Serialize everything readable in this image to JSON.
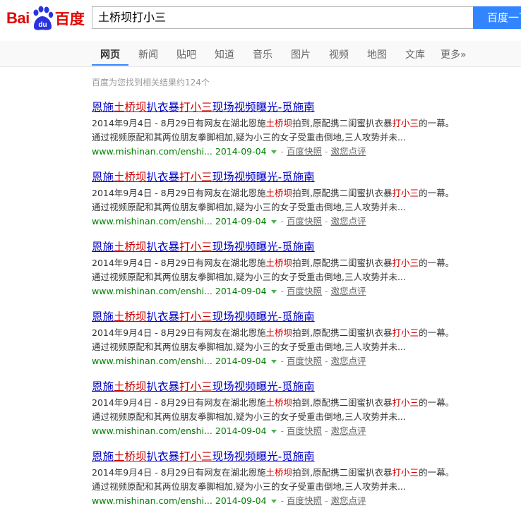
{
  "logo": {
    "latin_part": "Bai",
    "paw_text": "du",
    "chinese_part": "百度"
  },
  "search": {
    "query": "土桥坝打小三",
    "button_label": "百度一下"
  },
  "tabs": [
    {
      "label": "网页",
      "active": true
    },
    {
      "label": "新闻"
    },
    {
      "label": "贴吧"
    },
    {
      "label": "知道"
    },
    {
      "label": "音乐"
    },
    {
      "label": "图片"
    },
    {
      "label": "视频"
    },
    {
      "label": "地图"
    },
    {
      "label": "文库"
    },
    {
      "label": "更多»"
    }
  ],
  "result_count": "百度为您找到相关结果约124个",
  "colors": {
    "brand_red": "#e10602",
    "search_blue": "#3385ff",
    "link_blue": "#0000cc",
    "highlight_red": "#cc0000",
    "url_green": "#008000"
  },
  "results": [
    {
      "title": {
        "t1": "恩施",
        "h1": "土桥坝",
        "t2": "扒衣暴",
        "h2": "打小三",
        "t3": "现场视频曝光-觅施南"
      },
      "abstract": {
        "a1": "2014年9月4日 - 8月29日有网友在湖北恩施",
        "h1": "土桥坝",
        "a2": "拍到,原配携二闺蜜扒衣暴",
        "h2": "打小三",
        "a3": "的一幕。",
        "line2": "通过视频原配和其两位朋友拳脚相加,疑为小三的女子受重击倒地,三人攻势并未..."
      },
      "url": "www.mishinan.com/enshi...",
      "date": "2014-09-04",
      "sep": "-",
      "snapshot": "百度快照",
      "invite": "邀您点评"
    },
    {
      "title": {
        "t1": "恩施",
        "h1": "土桥坝",
        "t2": "扒衣暴",
        "h2": "打小三",
        "t3": "现场视频曝光-觅施南"
      },
      "abstract": {
        "a1": "2014年9月4日 - 8月29日有网友在湖北恩施",
        "h1": "土桥坝",
        "a2": "拍到,原配携二闺蜜扒衣暴",
        "h2": "打小三",
        "a3": "的一幕。",
        "line2": "通过视频原配和其两位朋友拳脚相加,疑为小三的女子受重击倒地,三人攻势并未..."
      },
      "url": "www.mishinan.com/enshi...",
      "date": "2014-09-04",
      "sep": "-",
      "snapshot": "百度快照",
      "invite": "邀您点评"
    },
    {
      "title": {
        "t1": "恩施",
        "h1": "土桥坝",
        "t2": "扒衣暴",
        "h2": "打小三",
        "t3": "现场视频曝光-觅施南"
      },
      "abstract": {
        "a1": "2014年9月4日 - 8月29日有网友在湖北恩施",
        "h1": "土桥坝",
        "a2": "拍到,原配携二闺蜜扒衣暴",
        "h2": "打小三",
        "a3": "的一幕。",
        "line2": "通过视频原配和其两位朋友拳脚相加,疑为小三的女子受重击倒地,三人攻势并未..."
      },
      "url": "www.mishinan.com/enshi...",
      "date": "2014-09-04",
      "sep": "-",
      "snapshot": "百度快照",
      "invite": "邀您点评"
    },
    {
      "title": {
        "t1": "恩施",
        "h1": "土桥坝",
        "t2": "扒衣暴",
        "h2": "打小三",
        "t3": "现场视频曝光-觅施南"
      },
      "abstract": {
        "a1": "2014年9月4日 - 8月29日有网友在湖北恩施",
        "h1": "土桥坝",
        "a2": "拍到,原配携二闺蜜扒衣暴",
        "h2": "打小三",
        "a3": "的一幕。",
        "line2": "通过视频原配和其两位朋友拳脚相加,疑为小三的女子受重击倒地,三人攻势并未..."
      },
      "url": "www.mishinan.com/enshi...",
      "date": "2014-09-04",
      "sep": "-",
      "snapshot": "百度快照",
      "invite": "邀您点评"
    },
    {
      "title": {
        "t1": "恩施",
        "h1": "土桥坝",
        "t2": "扒衣暴",
        "h2": "打小三",
        "t3": "现场视频曝光-觅施南"
      },
      "abstract": {
        "a1": "2014年9月4日 - 8月29日有网友在湖北恩施",
        "h1": "土桥坝",
        "a2": "拍到,原配携二闺蜜扒衣暴",
        "h2": "打小三",
        "a3": "的一幕。",
        "line2": "通过视频原配和其两位朋友拳脚相加,疑为小三的女子受重击倒地,三人攻势并未..."
      },
      "url": "www.mishinan.com/enshi...",
      "date": "2014-09-04",
      "sep": "-",
      "snapshot": "百度快照",
      "invite": "邀您点评"
    },
    {
      "title": {
        "t1": "恩施",
        "h1": "土桥坝",
        "t2": "扒衣暴",
        "h2": "打小三",
        "t3": "现场视频曝光-觅施南"
      },
      "abstract": {
        "a1": "2014年9月4日 - 8月29日有网友在湖北恩施",
        "h1": "土桥坝",
        "a2": "拍到,原配携二闺蜜扒衣暴",
        "h2": "打小三",
        "a3": "的一幕。",
        "line2": "通过视频原配和其两位朋友拳脚相加,疑为小三的女子受重击倒地,三人攻势并未..."
      },
      "url": "www.mishinan.com/enshi...",
      "date": "2014-09-04",
      "sep": "-",
      "snapshot": "百度快照",
      "invite": "邀您点评"
    }
  ]
}
